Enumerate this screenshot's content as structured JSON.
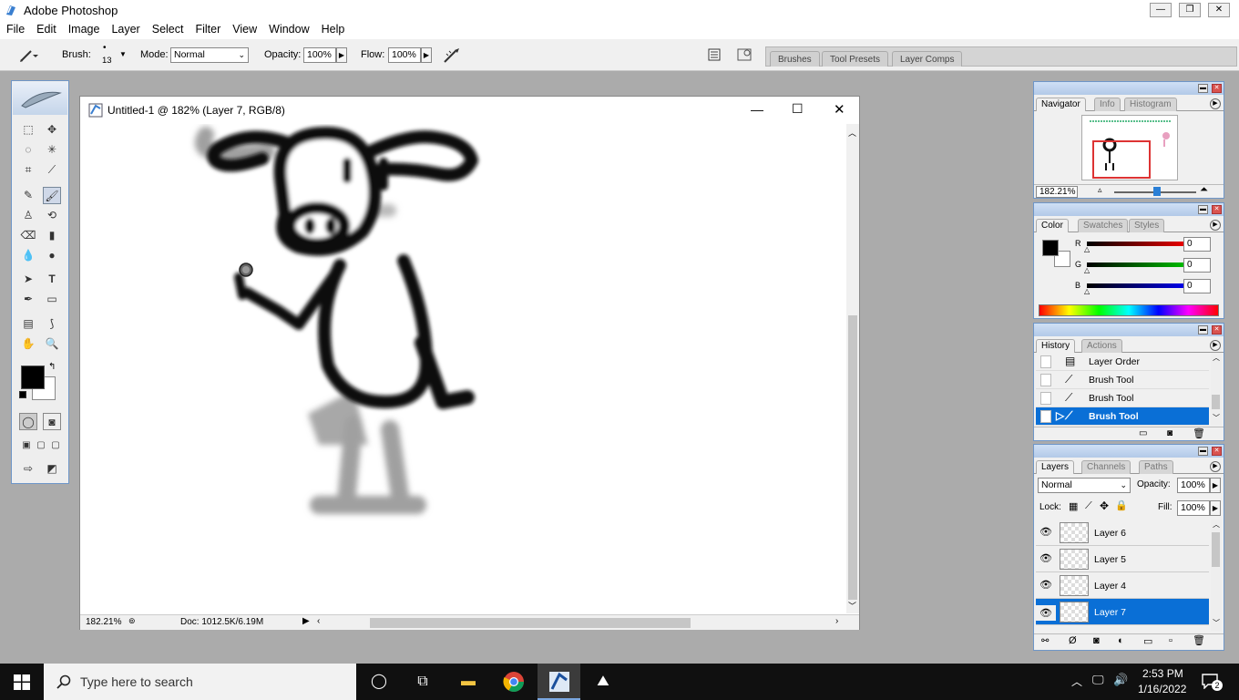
{
  "app": {
    "title": "Adobe Photoshop"
  },
  "window_buttons": {
    "minimize": "—",
    "restore": "❐",
    "close": "✕"
  },
  "menu": [
    "File",
    "Edit",
    "Image",
    "Layer",
    "Select",
    "Filter",
    "View",
    "Window",
    "Help"
  ],
  "options": {
    "brush_label": "Brush:",
    "brush_size": "13",
    "mode_label": "Mode:",
    "mode_value": "Normal",
    "opacity_label": "Opacity:",
    "opacity_value": "100%",
    "flow_label": "Flow:",
    "flow_value": "100%"
  },
  "well_tabs": [
    "Brushes",
    "Tool Presets",
    "Layer Comps"
  ],
  "document": {
    "title": "Untitled-1 @ 182% (Layer 7, RGB/8)",
    "zoom": "182.21%",
    "doc_size": "Doc: 1012.5K/6.19M"
  },
  "navigator": {
    "tabs": [
      "Navigator",
      "Info",
      "Histogram"
    ],
    "zoom": "182.21%"
  },
  "color": {
    "tabs": [
      "Color",
      "Swatches",
      "Styles"
    ],
    "r_label": "R",
    "g_label": "G",
    "b_label": "B",
    "r_value": "0",
    "g_value": "0",
    "b_value": "0",
    "foreground": "#000000",
    "background": "#ffffff"
  },
  "history": {
    "tabs": [
      "History",
      "Actions"
    ],
    "items": [
      "Layer Order",
      "Brush Tool",
      "Brush Tool",
      "Brush Tool"
    ],
    "selected_index": 3
  },
  "layers": {
    "tabs": [
      "Layers",
      "Channels",
      "Paths"
    ],
    "blend_mode": "Normal",
    "opacity_label": "Opacity:",
    "opacity_value": "100%",
    "lock_label": "Lock:",
    "fill_label": "Fill:",
    "fill_value": "100%",
    "items": [
      "Layer 6",
      "Layer 5",
      "Layer 4",
      "Layer 7"
    ],
    "selected_index": 3
  },
  "taskbar": {
    "search_placeholder": "Type here to search",
    "time": "2:53 PM",
    "date": "1/16/2022",
    "notifications": "2"
  },
  "colors": {
    "accent": "#0a6fd6",
    "palette_border": "#6e96c8"
  }
}
